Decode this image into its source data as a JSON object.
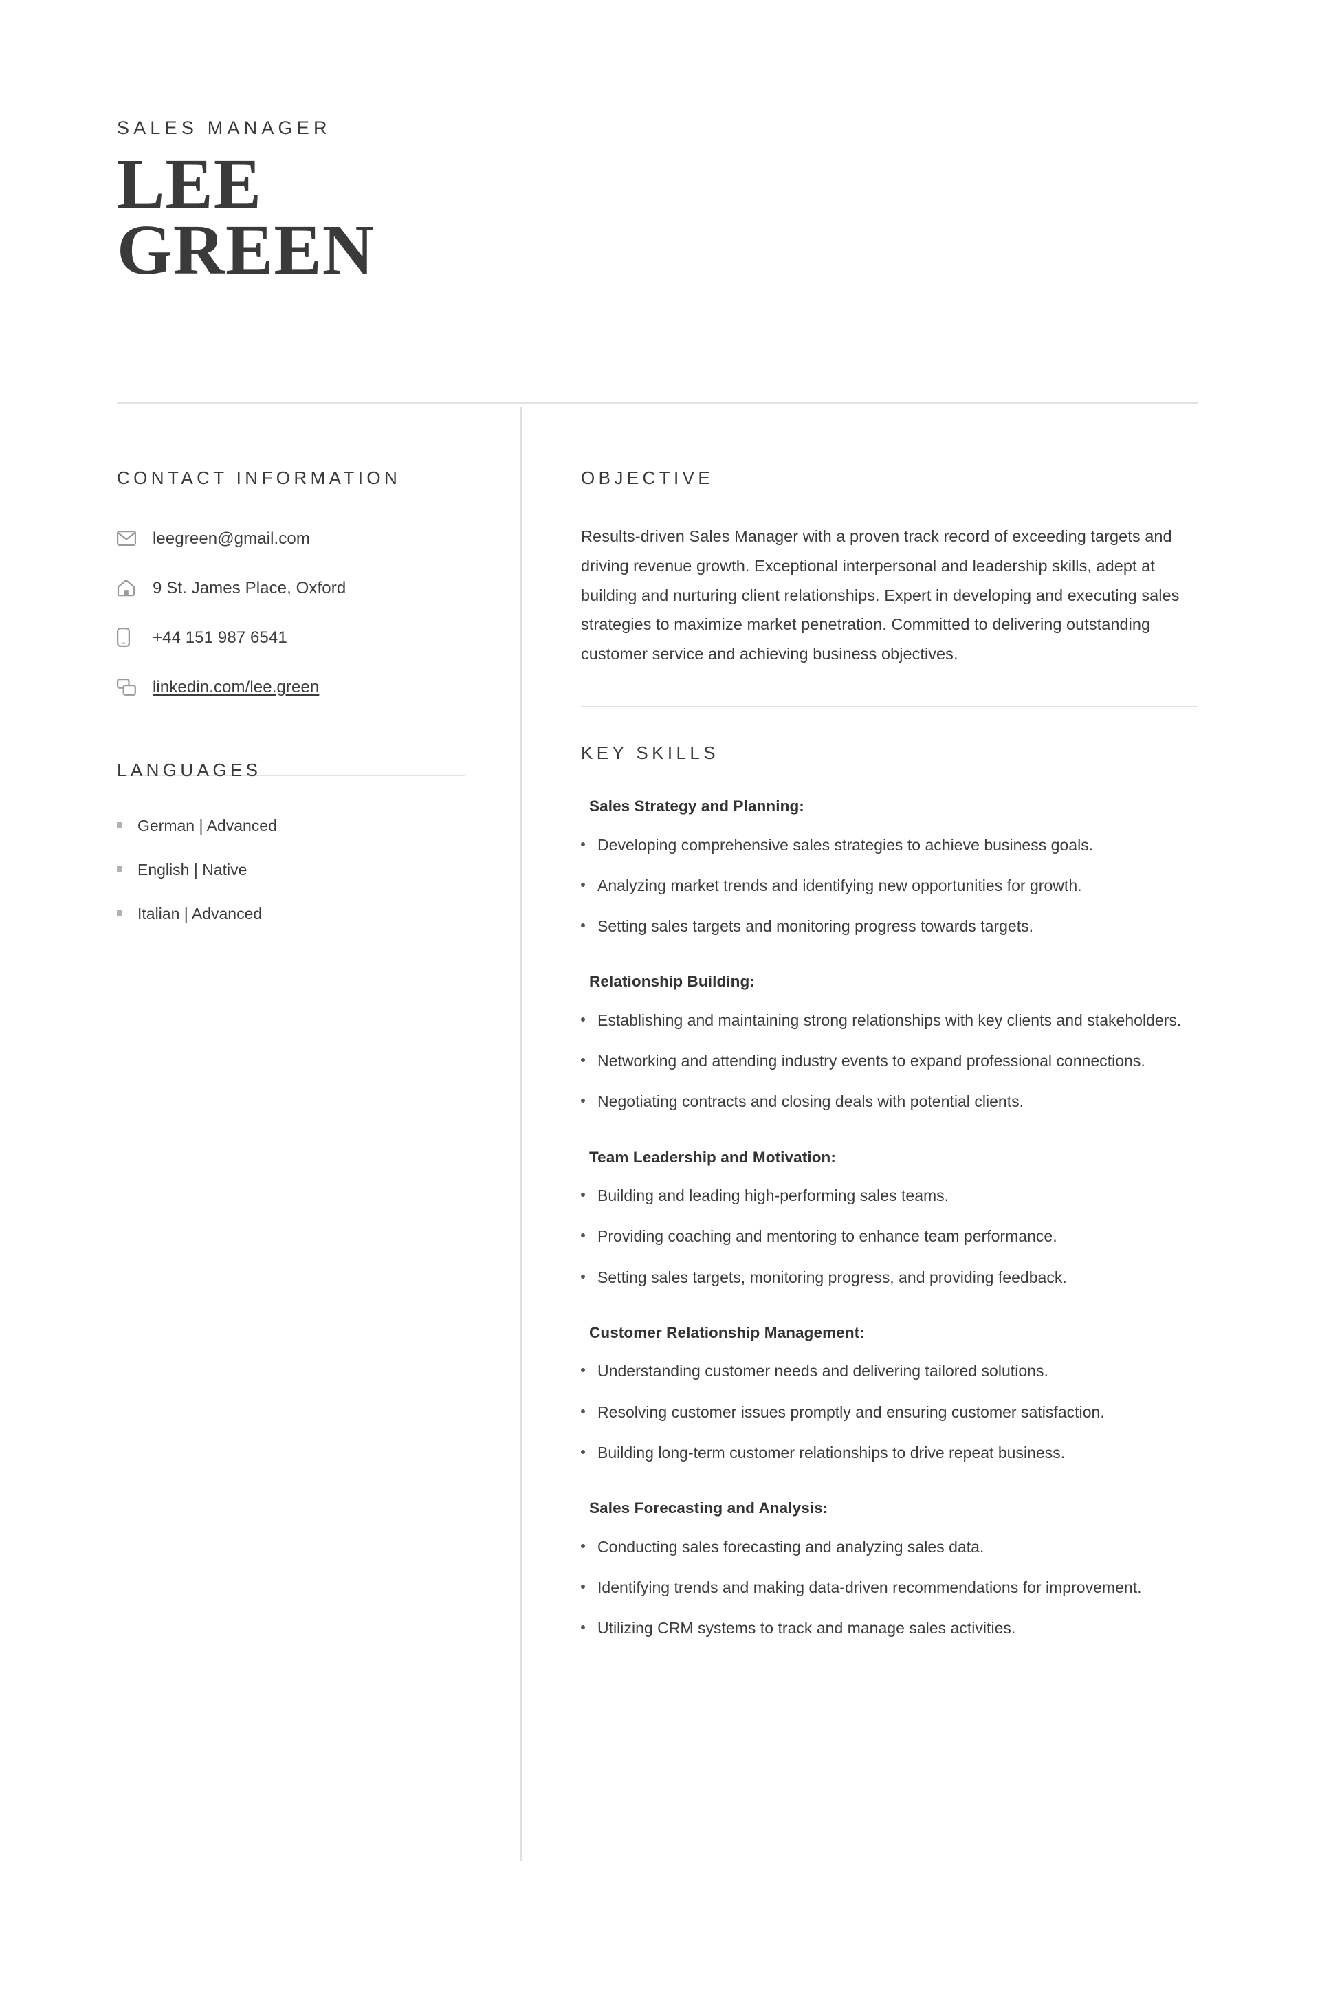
{
  "document": {
    "type": "resume",
    "accent_color": "#3a3a3a",
    "text_color": "#3c3c3c",
    "divider_color": "#e2e2e2"
  },
  "header": {
    "job_title": "SALES MANAGER",
    "first_name": "LEE",
    "last_name": "GREEN"
  },
  "contact": {
    "heading": "CONTACT INFORMATION",
    "items": [
      {
        "icon": "envelope-icon",
        "value": "leegreen@gmail.com",
        "is_link": false
      },
      {
        "icon": "home-icon",
        "value": "9 St. James Place, Oxford",
        "is_link": false
      },
      {
        "icon": "phone-icon",
        "value": "+44 151 987 6541",
        "is_link": false
      },
      {
        "icon": "link-pages-icon",
        "value": "linkedin.com/lee.green",
        "is_link": true
      }
    ]
  },
  "languages": {
    "heading": "LANGUAGES",
    "items": [
      {
        "label": "German | Advanced"
      },
      {
        "label": "English | Native"
      },
      {
        "label": "Italian | Advanced"
      }
    ]
  },
  "objective": {
    "heading": "OBJECTIVE",
    "body": "Results-driven Sales Manager with a proven track record of exceeding targets and driving revenue growth. Exceptional interpersonal and leadership skills, adept at building and nurturing client relationships. Expert in developing and executing sales strategies to maximize market penetration. Committed to delivering outstanding customer service and achieving business objectives."
  },
  "key_skills": {
    "heading": "KEY SKILLS",
    "groups": [
      {
        "title": "Sales Strategy and Planning:",
        "bullets": [
          "Developing comprehensive sales strategies to achieve business goals.",
          "Analyzing market trends and identifying new opportunities for growth.",
          "Setting sales targets and monitoring progress towards targets."
        ]
      },
      {
        "title": "Relationship Building:",
        "bullets": [
          "Establishing and maintaining strong relationships with key clients and stakeholders.",
          "Networking and attending industry events to expand professional connections.",
          "Negotiating contracts and closing deals with potential clients."
        ]
      },
      {
        "title": "Team Leadership and Motivation:",
        "bullets": [
          "Building and leading high-performing sales teams.",
          "Providing coaching and mentoring to enhance team performance.",
          "Setting sales targets, monitoring progress, and providing feedback."
        ]
      },
      {
        "title": "Customer Relationship Management:",
        "bullets": [
          "Understanding customer needs and delivering tailored solutions.",
          "Resolving customer issues promptly and ensuring customer satisfaction.",
          "Building long-term customer relationships to drive repeat business."
        ]
      },
      {
        "title": "Sales Forecasting and Analysis:",
        "bullets": [
          "Conducting sales forecasting and analyzing sales data.",
          "Identifying trends and making data-driven recommendations for improvement.",
          "Utilizing CRM systems to track and manage sales activities."
        ]
      }
    ]
  }
}
